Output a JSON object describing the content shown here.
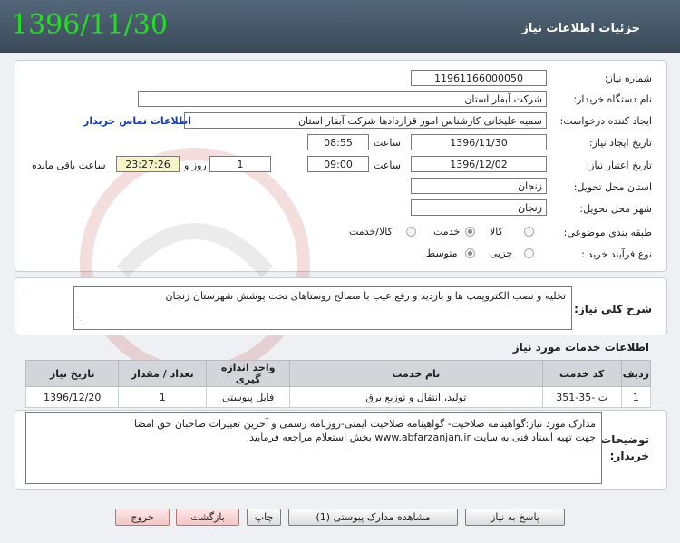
{
  "header": {
    "title": "جزئیات اطلاعات نیاز",
    "date": "1396/11/30"
  },
  "form": {
    "need_number": {
      "label": "شماره نیاز:",
      "value": "11961166000050"
    },
    "buyer_org": {
      "label": "نام دستگاه خریدار:",
      "value": "شرکت آبفار استان"
    },
    "requester": {
      "label": "ایجاد کننده درخواست:",
      "value": "سمیه علیخانی کارشناس امور قراردادها  شرکت آبفار استان",
      "contact_link": "اطلاعات تماس خریدار"
    },
    "created": {
      "label": "تاریخ ایجاد نیاز:",
      "date": "1396/11/30",
      "time_label": "ساعت",
      "time": "08:55"
    },
    "validity": {
      "label": "تاریخ اعتبار نیاز:",
      "date": "1396/12/02",
      "time_label": "ساعت",
      "time": "09:00",
      "days": "1",
      "days_label": "روز و",
      "remaining": "23:27:26",
      "remaining_label": "ساعت باقی مانده"
    },
    "province": {
      "label": "استان محل تحویل:",
      "value": "زنجان"
    },
    "city": {
      "label": "شهر محل تحویل:",
      "value": "زنجان"
    },
    "category": {
      "label": "طبقه بندی موضوعی:",
      "options": [
        "کالا",
        "خدمت",
        "کالا/خدمت"
      ],
      "selected": "خدمت"
    },
    "process": {
      "label": "نوع فرآیند خرید :",
      "options": [
        "جزیی",
        "متوسط"
      ],
      "selected": "متوسط"
    }
  },
  "description": {
    "label": "شرح کلی نیاز:",
    "value": "تخلیه و نصب الکتروپمپ ها و بازدید و رفع عیب با مصالح روستاهای تحت پوشش شهرستان زنجان"
  },
  "services": {
    "title": "اطلاعات خدمات مورد نیاز",
    "columns": [
      "ردیف",
      "کد خدمت",
      "نام خدمت",
      "واحد اندازه گیری",
      "تعداد / مقدار",
      "تاریخ نیاز"
    ],
    "rows": [
      [
        "1",
        "ت -35-351",
        "تولید، انتقال و توزیع برق",
        "فایل پیوستی",
        "1",
        "1396/12/20"
      ]
    ]
  },
  "buyer_notes": {
    "label_line1": "توضیحات",
    "label_line2": "خریدار:",
    "line1": "مدارک مورد نیاز:گواهینامه صلاحیت- گواهینامه صلاحیت ایمنی-روزنامه رسمی و آخرین تغییرات صاحبان حق امضا",
    "line2": "جهت تهیه اسناد فنی به سایت www.abfarzanjan.ir بخش استعلام مراجعه فرمایید."
  },
  "buttons": {
    "reply": "پاسخ به نیاز",
    "view_docs": "مشاهده مدارک پیوستی (1)",
    "print": "چاپ",
    "back": "بازگشت",
    "exit": "خروج"
  },
  "colors": {
    "header_bg": "#3f4f5e",
    "date_green": "#22dd22",
    "link_blue": "#1a3ea8",
    "yellow_box": "#f5f5c8"
  }
}
